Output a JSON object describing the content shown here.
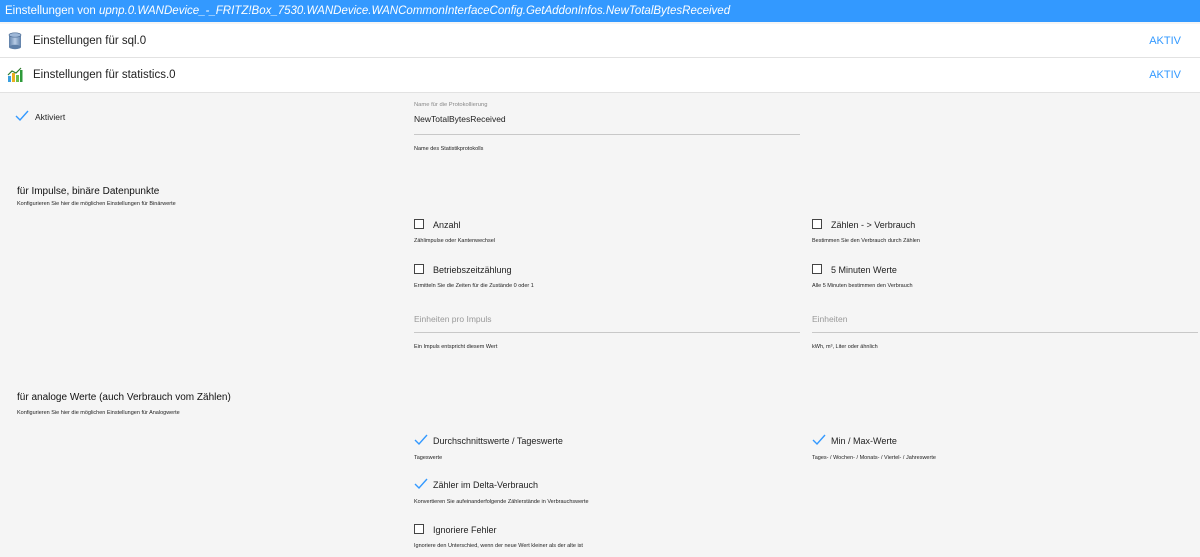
{
  "window": {
    "title_prefix": "Einstellungen von",
    "title_instance": "upnp.0.WANDevice_-_FRITZ!Box_7530.WANDevice.WANCommonInterfaceConfig.GetAddonInfos.NewTotalBytesReceived"
  },
  "panels": [
    {
      "title": "Einstellungen für sql.0",
      "status": "AKTIV",
      "icon": "database-icon"
    },
    {
      "title": "Einstellungen für statistics.0",
      "status": "AKTIV",
      "icon": "statistics-chart-icon"
    }
  ],
  "settings": {
    "enabled": {
      "label": "Aktiviert",
      "checked": true
    },
    "log_name": {
      "label": "Name für die Protokollierung",
      "value": "NewTotalBytesReceived",
      "help": "Name des Statistikprotokolls"
    }
  },
  "impulse": {
    "title": "für Impulse, binäre Datenpunkte",
    "subtitle": "Konfigurieren Sie hier die möglichen Einstellungen für Binärwerte",
    "count": {
      "label": "Anzahl",
      "help": "Zählimpulse oder Kantenwechsel",
      "checked": false
    },
    "sum_delta": {
      "label": "Zählen - > Verbrauch",
      "help": "Bestimmen Sie den Verbrauch durch Zählen",
      "checked": false
    },
    "time_count": {
      "label": "Betriebszeitzählung",
      "help": "Ermitteln Sie die Zeiten für die Zustände 0 oder 1",
      "checked": false
    },
    "five_min": {
      "label": "5 Minuten Werte",
      "help": "Alle 5 Minuten bestimmen den Verbrauch",
      "checked": false
    },
    "impulse_unit": {
      "placeholder": "Einheiten pro Impuls",
      "help": "Ein Impuls entspricht diesem Wert"
    },
    "unit": {
      "placeholder": "Einheiten",
      "help": "kWh, m³, Liter oder ähnlich"
    }
  },
  "analog": {
    "title": "für analoge Werte (auch Verbrauch vom Zählen)",
    "subtitle": "Konfigurieren Sie hier die möglichen Einstellungen für Analogwerte",
    "avg": {
      "label": "Durchschnittswerte / Tageswerte",
      "help": "Tageswerte",
      "checked": true
    },
    "minmax": {
      "label": "Min / Max-Werte",
      "help": "Tages- / Wochen- / Monats- / Viertel- / Jahreswerte",
      "checked": true
    },
    "delta": {
      "label": "Zähler im Delta-Verbrauch",
      "help": "Konvertieren Sie aufeinanderfolgende Zählerstände in Verbrauchswerte",
      "checked": true
    },
    "ignore_errors": {
      "label": "Ignoriere Fehler",
      "help": "Ignoriere den Unterschied, wenn der neue Wert kleiner als der alte ist",
      "checked": false
    }
  },
  "colors": {
    "accent": "#3399ff",
    "background": "#f5f5f5",
    "panel": "#ffffff"
  }
}
